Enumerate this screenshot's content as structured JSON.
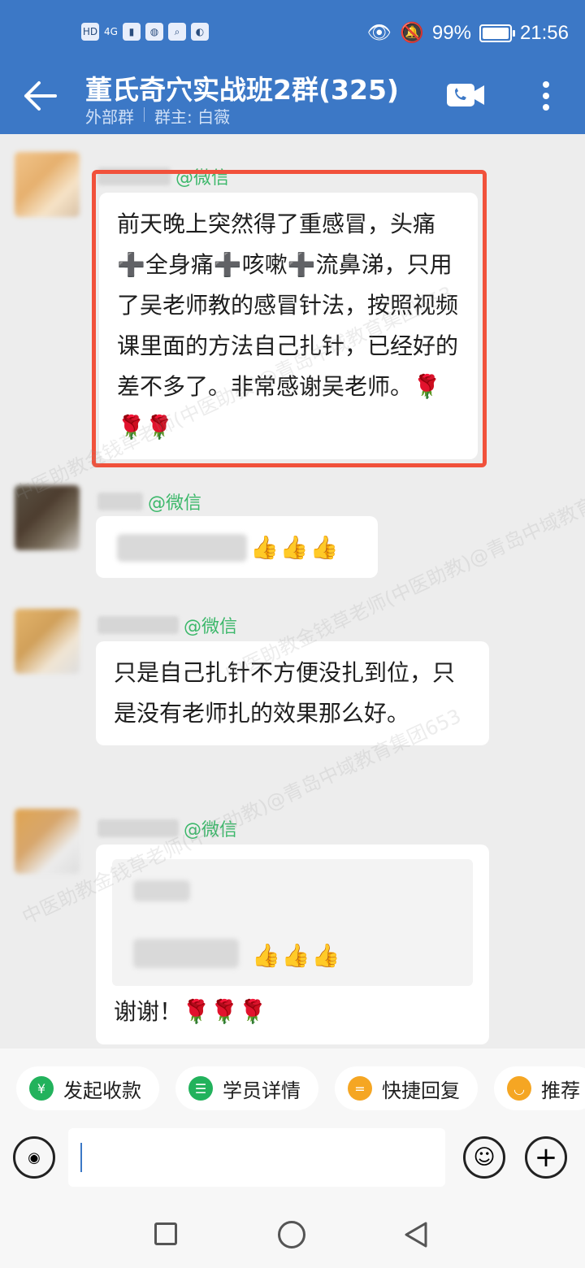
{
  "status_bar": {
    "left_icons": [
      "HD",
      "4G"
    ],
    "battery": "99%",
    "time": "21:56"
  },
  "header": {
    "title": "董氏奇穴实战班2群(325)",
    "tag": "外部群",
    "owner": "群主: 白薇"
  },
  "messages": [
    {
      "sender_suffix": "@微信",
      "text": "前天晚上突然得了重感冒，头痛➕全身痛➕咳嗽➕流鼻涕，只用了吴老师教的感冒针法，按照视频课里面的方法自己扎针，已经好的差不多了。非常感谢吴老师。🌹🌹🌹"
    },
    {
      "sender_suffix": "@微信",
      "emoji": "👍👍👍"
    },
    {
      "sender_suffix": "@微信",
      "text": "只是自己扎针不方便没扎到位，只是没有老师扎的效果那么好。"
    },
    {
      "sender_suffix": "@微信",
      "quote_emoji": "👍👍👍",
      "text": "谢谢！🌹🌹🌹"
    }
  ],
  "quick_actions": [
    {
      "label": "发起收款",
      "icon": "yen-shield-icon",
      "color": "#22b25c"
    },
    {
      "label": "学员详情",
      "icon": "user-list-icon",
      "color": "#22b25c"
    },
    {
      "label": "快捷回复",
      "icon": "quick-reply-icon",
      "color": "#f5a623"
    },
    {
      "label": "推荐",
      "icon": "recommend-icon",
      "color": "#f5a623"
    }
  ],
  "watermark": "中医助教金钱草老师(中医助教)@青岛中域教育集团653"
}
